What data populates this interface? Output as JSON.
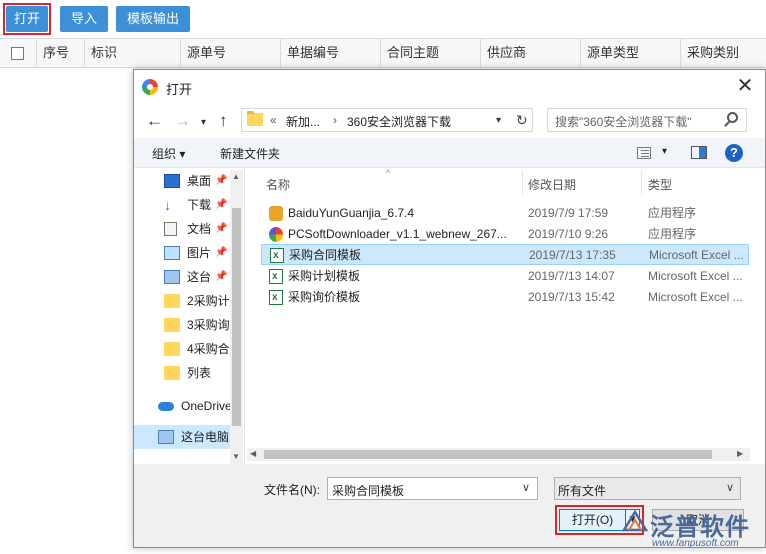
{
  "toolbar": {
    "open_label": "打开",
    "import_label": "导入",
    "export_template_label": "模板输出"
  },
  "table": {
    "columns": [
      "序号",
      "标识",
      "源单号",
      "单据编号",
      "合同主题",
      "供应商",
      "源单类型",
      "采购类别"
    ]
  },
  "dialog": {
    "title": "打开",
    "address": {
      "overflow": "«",
      "part1": "新加...",
      "sep": "›",
      "part2": "360安全浏览器下载"
    },
    "search_placeholder": "搜索\"360安全浏览器下载\"",
    "organize_label": "组织 ▾",
    "new_folder_label": "新建文件夹",
    "help_label": "?",
    "nav_items": [
      {
        "label": "桌面",
        "icon": "desktop-icon",
        "pinned": true
      },
      {
        "label": "下载",
        "icon": "download-icon",
        "pinned": true
      },
      {
        "label": "文档",
        "icon": "document-icon",
        "pinned": true
      },
      {
        "label": "图片",
        "icon": "picture-icon",
        "pinned": true
      },
      {
        "label": "这台",
        "icon": "computer-icon",
        "pinned": true
      },
      {
        "label": "2采购计",
        "icon": "folder-icon"
      },
      {
        "label": "3采购询",
        "icon": "folder-icon"
      },
      {
        "label": "4采购合",
        "icon": "folder-icon"
      },
      {
        "label": "列表",
        "icon": "folder-icon"
      },
      {
        "label": "OneDrive",
        "icon": "cloud-icon"
      },
      {
        "label": "这台电脑",
        "icon": "computer-icon",
        "selected": true
      }
    ],
    "col_headers": {
      "name": "名称",
      "date": "修改日期",
      "type": "类型"
    },
    "files": [
      {
        "name": "BaiduYunGuanjia_6.7.4",
        "date": "2019/7/9 17:59",
        "type": "应用程序",
        "icon": "app-icon"
      },
      {
        "name": "PCSoftDownloader_v1.1_webnew_267...",
        "date": "2019/7/10 9:26",
        "type": "应用程序",
        "icon": "app-icon"
      },
      {
        "name": "采购合同模板",
        "date": "2019/7/13 17:35",
        "type": "Microsoft Excel ...",
        "icon": "excel-file-icon",
        "selected": true
      },
      {
        "name": "采购计划模板",
        "date": "2019/7/13 14:07",
        "type": "Microsoft Excel ...",
        "icon": "excel-file-icon"
      },
      {
        "name": "采购询价模板",
        "date": "2019/7/13 15:42",
        "type": "Microsoft Excel ...",
        "icon": "excel-file-icon"
      }
    ],
    "filename_label": "文件名(N):",
    "filename_value": "采购合同模板",
    "filetype_value": "所有文件",
    "open_button": "打开(O)",
    "cancel_button": "取消"
  },
  "watermark": {
    "brand": "泛普软件",
    "url": "www.fanpusoft.com"
  },
  "colors": {
    "accent": "#3d8fd8",
    "highlight_frame": "#e02424",
    "selection": "#cce8ff"
  }
}
